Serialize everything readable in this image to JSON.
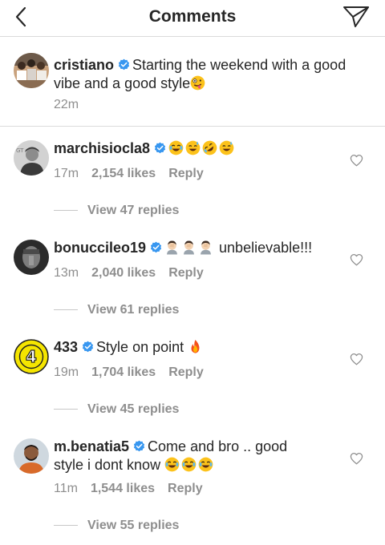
{
  "header": {
    "title": "Comments",
    "back_icon": "chevron-left-icon",
    "send_icon": "paper-plane-icon"
  },
  "caption": {
    "username": "cristiano",
    "text": "Starting the weekend with a good vibe and a good style",
    "emoji": "zany-face",
    "time": "22m"
  },
  "comments": [
    {
      "username": "marchisiocla8",
      "text": "",
      "emojis": [
        "laughing-tears",
        "sweat-smile",
        "rofl",
        "sweat-smile"
      ],
      "time": "17m",
      "likes": "2,154 likes",
      "reply_label": "Reply",
      "view_replies": "View 47 replies"
    },
    {
      "username": "bonuccileo19",
      "text": "unbelievable!!!",
      "emojis": [
        "facepalm",
        "facepalm",
        "facepalm"
      ],
      "time": "13m",
      "likes": "2,040 likes",
      "reply_label": "Reply",
      "view_replies": "View 61 replies"
    },
    {
      "username": "433",
      "text": "Style on point",
      "emojis": [
        "fire"
      ],
      "time": "19m",
      "likes": "1,704 likes",
      "reply_label": "Reply",
      "view_replies": "View 45 replies"
    },
    {
      "username": "m.benatia5",
      "text_line1": "Come and bro .. good",
      "text_line2": "style i dont know",
      "emojis": [
        "laughing-tears",
        "laughing-tears",
        "laughing-tears"
      ],
      "time": "11m",
      "likes": "1,544 likes",
      "reply_label": "Reply",
      "view_replies": "View 55 replies"
    }
  ],
  "colors": {
    "text": "#262626",
    "secondary": "#8e8e8e",
    "divider": "#dbdbdb",
    "verified": "#3897f0",
    "avatar_433_bg": "#f5e500"
  }
}
